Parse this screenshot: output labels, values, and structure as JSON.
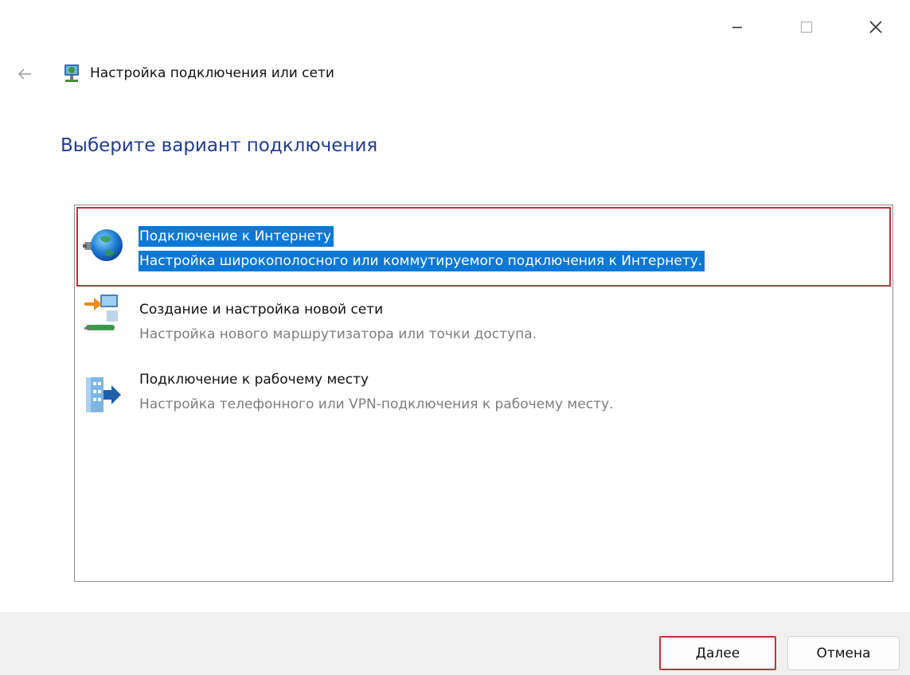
{
  "window": {
    "controls": [
      "minimize-icon",
      "maximize-icon",
      "close-icon"
    ]
  },
  "header": {
    "back_icon": "back-arrow-icon",
    "icon": "network-setup-icon",
    "title": "Настройка подключения или сети"
  },
  "main": {
    "heading": "Выберите вариант подключения",
    "options": [
      {
        "title": "Подключение к Интернету",
        "description": "Настройка широкополосного или коммутируемого подключения к Интернету.",
        "icon": "globe-internet-icon",
        "selected": true
      },
      {
        "title": "Создание и настройка новой сети",
        "description": "Настройка нового маршрутизатора или точки доступа.",
        "icon": "new-network-icon",
        "selected": false
      },
      {
        "title": "Подключение к рабочему месту",
        "description": "Настройка телефонного или VPN-подключения к рабочему месту.",
        "icon": "workplace-connection-icon",
        "selected": false
      }
    ]
  },
  "footer": {
    "next_label": "Далее",
    "cancel_label": "Отмена"
  },
  "colors": {
    "heading": "#1f3d8f",
    "selection_background": "#0a78d6",
    "highlight_border": "#c2323a",
    "description_text": "#7d7d7d"
  }
}
